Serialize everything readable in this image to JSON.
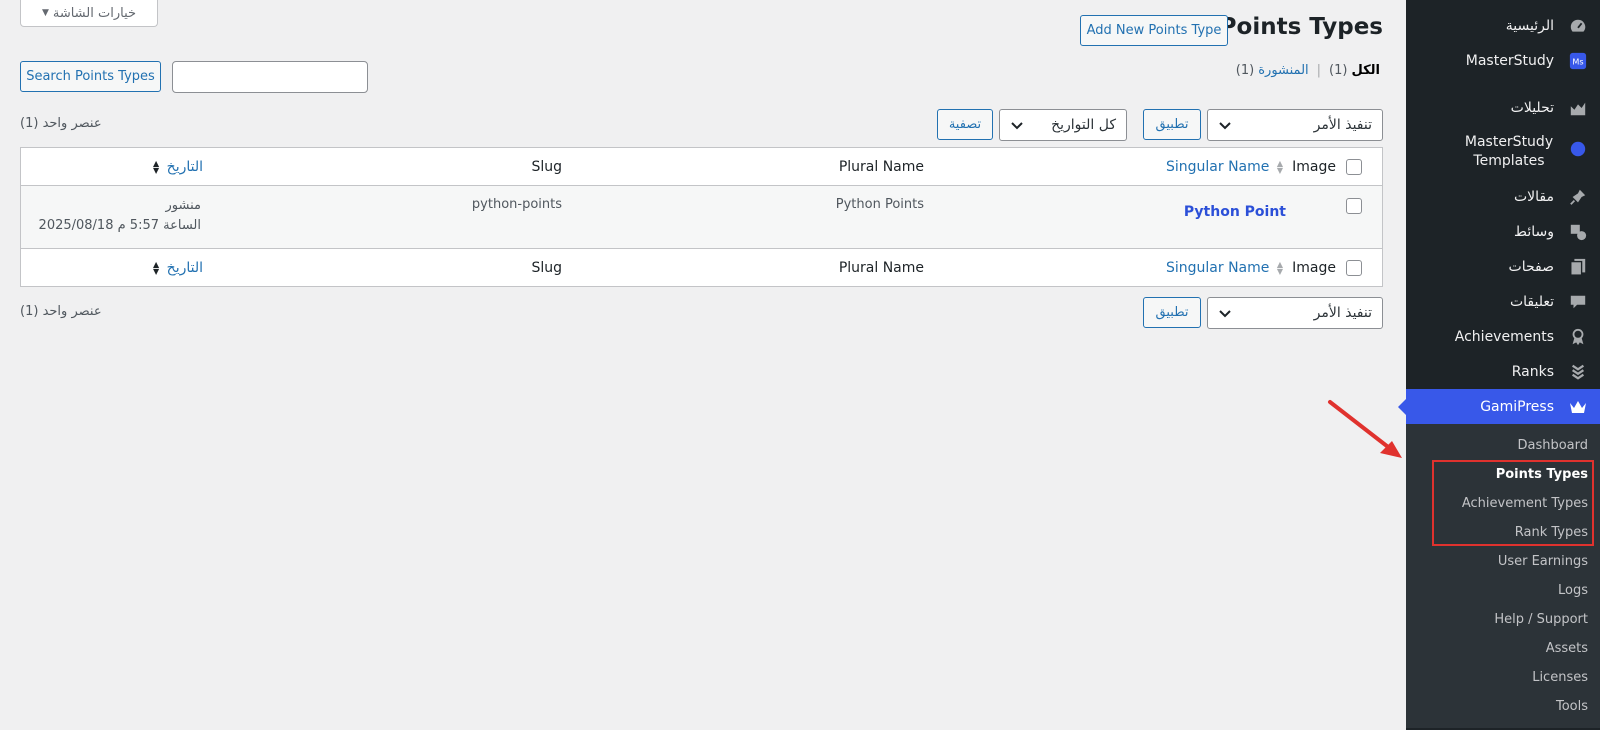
{
  "sidebar": {
    "items": [
      {
        "label": "الرئيسية",
        "icon": "dashboard-icon"
      },
      {
        "label": "MasterStudy",
        "icon": "masterstudy-icon"
      },
      {
        "label": "تحليلات",
        "icon": "analytics-icon"
      },
      {
        "label": "MasterStudy Templates",
        "icon": "templates-icon"
      },
      {
        "label": "مقالات",
        "icon": "pin-icon"
      },
      {
        "label": "وسائط",
        "icon": "media-icon"
      },
      {
        "label": "صفحات",
        "icon": "pages-icon"
      },
      {
        "label": "تعليقات",
        "icon": "comments-icon"
      },
      {
        "label": "Achievements",
        "icon": "award-icon"
      },
      {
        "label": "Ranks",
        "icon": "ranks-icon"
      },
      {
        "label": "GamiPress",
        "icon": "crown-icon"
      }
    ],
    "submenu": [
      "Dashboard",
      "Points Types",
      "Achievement Types",
      "Rank Types",
      "User Earnings",
      "Logs",
      "Help / Support",
      "Assets",
      "Licenses",
      "Tools"
    ]
  },
  "header": {
    "screen_options": "خيارات الشاشة",
    "title": "Points Types",
    "add_new": "Add New Points Type"
  },
  "filters": {
    "all_label": "الكل",
    "all_count": "(1)",
    "published_label": "المنشورة",
    "published_count": "(1)",
    "separator": "|"
  },
  "search": {
    "button": "Search Points Types",
    "value": ""
  },
  "bulk": {
    "action_select": "تنفيذ الأمر",
    "apply": "تطبيق",
    "date_select": "كل التواريخ",
    "filter": "تصفية",
    "items_count": "عنصر واحد (1)"
  },
  "table": {
    "columns": {
      "image": "Image",
      "singular": "Singular Name",
      "plural": "Plural Name",
      "slug": "Slug",
      "date": "التاريخ"
    },
    "rows": [
      {
        "singular": "Python Point",
        "plural": "Python Points",
        "slug": "python-points",
        "status": "منشور",
        "date": "2025/08/18 الساعة 5:57 م"
      }
    ]
  },
  "colors": {
    "sidebar_bg": "#1d2327",
    "active": "#3858e9",
    "link": "#2271b1",
    "annotation": "#e0322e"
  }
}
